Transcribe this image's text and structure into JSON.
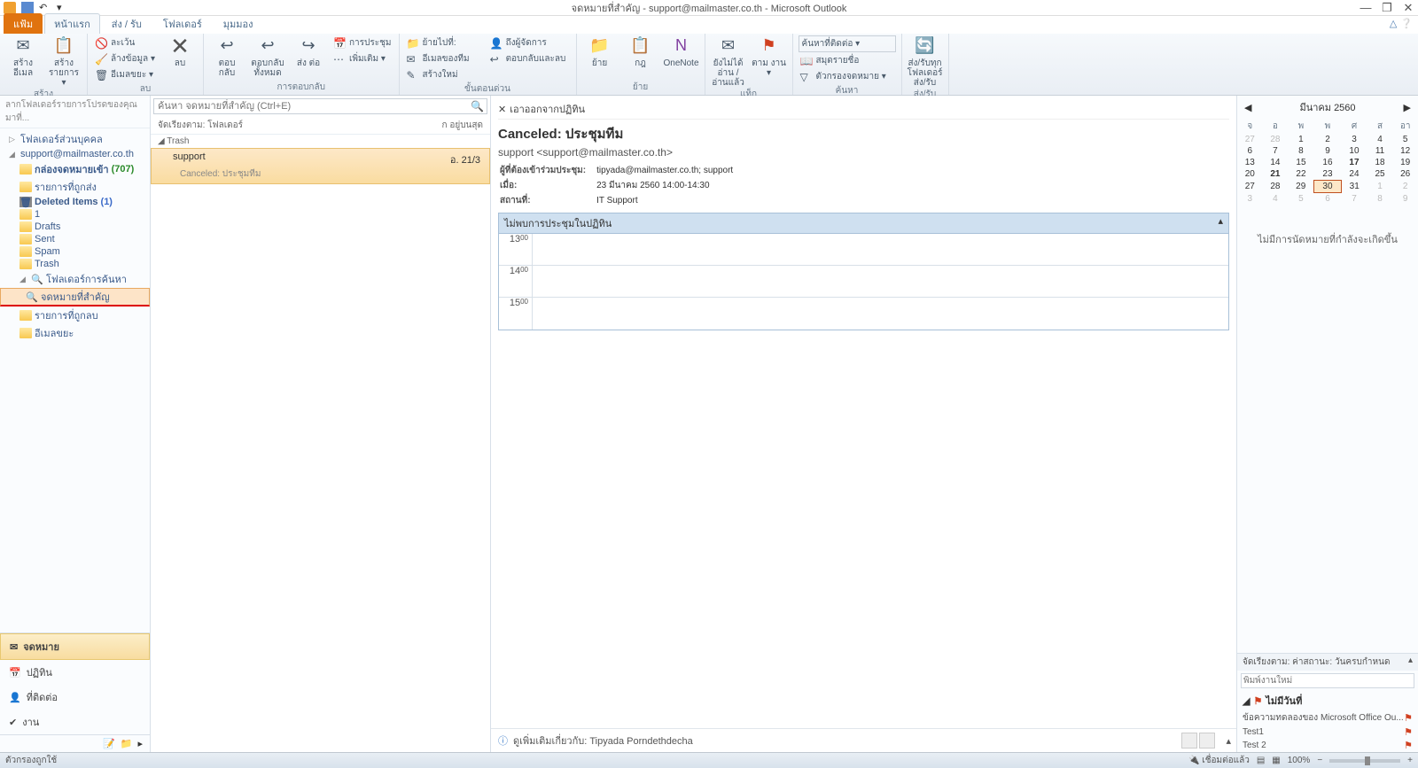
{
  "titlebar": {
    "title": "จดหมายที่สำคัญ - support@mailmaster.co.th - Microsoft Outlook"
  },
  "tabs": {
    "file": "แฟ้ม",
    "home": "หน้าแรก",
    "sendreceive": "ส่ง / รับ",
    "folder": "โฟลเดอร์",
    "view": "มุมมอง"
  },
  "ribbon": {
    "g_new": {
      "label": "สร้าง",
      "new_email": "สร้าง\nอีเมล",
      "new_items": "สร้าง\nรายการ ▾"
    },
    "g_delete": {
      "label": "ลบ",
      "ignore": "ละเว้น",
      "cleanup": "ล้างข้อมูล ▾",
      "junk": "อีเมลขยะ ▾",
      "delete": "ลบ"
    },
    "g_respond": {
      "label": "การตอบกลับ",
      "reply": "ตอบ\nกลับ",
      "replyall": "ตอบกลับ\nทั้งหมด",
      "forward": "ส่ง\nต่อ",
      "meeting": "การประชุม",
      "more": "เพิ่มเติม ▾"
    },
    "g_quick": {
      "label": "ขั้นตอนด่วน",
      "moveto": "ย้ายไปที่:",
      "teammail": "อีเมลของทีม",
      "createnew": "สร้างใหม่",
      "tomanager": "ถึงผู้จัดการ",
      "replydelete": "ตอบกลับและลบ"
    },
    "g_move": {
      "label": "ย้าย",
      "move": "ย้าย",
      "rules": "กฎ",
      "onenote": "OneNote"
    },
    "g_tags": {
      "label": "แท็ก",
      "unread": "ยังไม่ได้อ่าน\n/อ่านแล้ว",
      "followup": "ตาม\nงาน ▾"
    },
    "g_find": {
      "label": "ค้นหา",
      "findcontact": "ค้นหาที่ติดต่อ ▾",
      "addressbook": "สมุดรายชื่อ",
      "filter": "ตัวกรองจดหมาย ▾"
    },
    "g_sendrecv": {
      "label": "ส่ง/รับ",
      "btn": "ส่ง/รับทุก\nโฟลเดอร์\nส่ง/รับ"
    }
  },
  "leftpane": {
    "dragfav": "ลากโฟลเดอร์รายการโปรดของคุณมาที่...",
    "personal": "โฟลเดอร์ส่วนบุคคล",
    "account": "support@mailmaster.co.th",
    "inbox": "กล่องจดหมายเข้า",
    "inbox_count": "(707)",
    "sentitems": "รายการที่ถูกส่ง",
    "deleted": "Deleted Items",
    "deleted_count": "(1)",
    "f1": "1",
    "drafts": "Drafts",
    "sent": "Sent",
    "spam": "Spam",
    "trash": "Trash",
    "searchfolders": "โฟลเดอร์การค้นหา",
    "important": "จดหมายที่สำคัญ",
    "deleteditems2": "รายการที่ถูกลบ",
    "junk": "อีเมลขยะ"
  },
  "nav": {
    "mail": "จดหมาย",
    "calendar": "ปฏิทิน",
    "contacts": "ที่ติดต่อ",
    "tasks": "งาน"
  },
  "middlepane": {
    "search_placeholder": "ค้นหา จดหมายที่สำคัญ (Ctrl+E)",
    "sort_label": "จัดเรียงตาม: โฟลเดอร์",
    "sort_dir": "ก อยู่บนสุด",
    "group_trash": "Trash",
    "msg_from": "support",
    "msg_date": "อ. 21/3",
    "msg_subject": "Canceled: ประชุมทีม"
  },
  "reading": {
    "remove_action": "เอาออกจากปฏิทิน",
    "title": "Canceled: ประชุมทีม",
    "from": "support <support@mailmaster.co.th>",
    "required_label": "ผู้ที่ต้องเข้าร่วมประชุม:",
    "required": "tipyada@mailmaster.co.th; support",
    "when_label": "เมื่อ:",
    "when": "23 มีนาคม 2560 14:00-14:30",
    "where_label": "สถานที่:",
    "where": "IT Support",
    "notfound": "ไม่พบการประชุมในปฏิทิน",
    "time13": "13",
    "time14": "14",
    "time15": "15",
    "min": "00",
    "people_info": "ดูเพิ่มเติมเกี่ยวกับ: Tipyada Porndethdecha"
  },
  "rightpane": {
    "month": "มีนาคม 2560",
    "dow": [
      "จ",
      "อ",
      "พ",
      "พ",
      "ศ",
      "ส",
      "อา"
    ],
    "weeks": [
      [
        "27",
        "28",
        "1",
        "2",
        "3",
        "4",
        "5"
      ],
      [
        "6",
        "7",
        "8",
        "9",
        "10",
        "11",
        "12"
      ],
      [
        "13",
        "14",
        "15",
        "16",
        "17",
        "18",
        "19"
      ],
      [
        "20",
        "21",
        "22",
        "23",
        "24",
        "25",
        "26"
      ],
      [
        "27",
        "28",
        "29",
        "30",
        "31",
        "1",
        "2"
      ],
      [
        "3",
        "4",
        "5",
        "6",
        "7",
        "8",
        "9"
      ]
    ],
    "no_appt": "ไม่มีการนัดหมายที่กำลังจะเกิดขึ้น",
    "task_sort": "จัดเรียงตาม: ค่าสถานะ: วันครบกำหนด",
    "task_placeholder": "พิมพ์งานใหม่",
    "task_group": "ไม่มีวันที่",
    "task1": "ข้อความทดลองของ Microsoft Office Ou...",
    "task2": "Test1",
    "task3": "Test 2"
  },
  "statusbar": {
    "left": "ตัวกรองถูกใช้",
    "connected": "เชื่อมต่อแล้ว",
    "zoom": "100%"
  }
}
